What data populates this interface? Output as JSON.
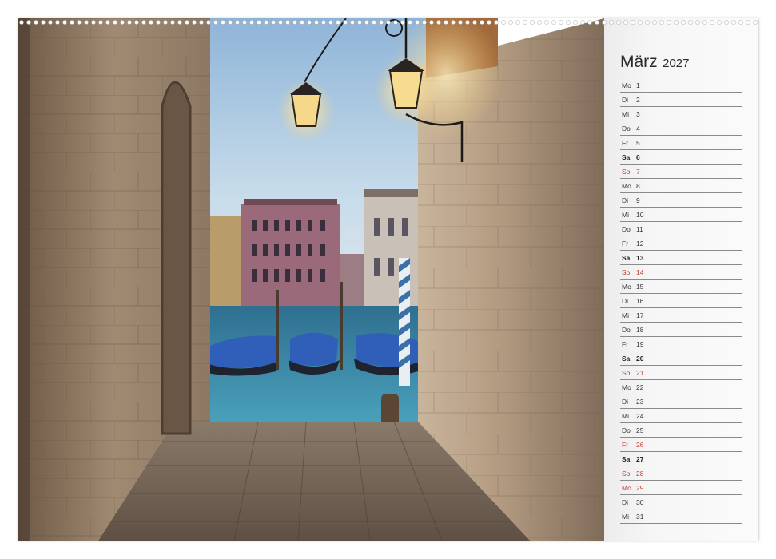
{
  "calendar": {
    "month": "März",
    "year": "2027",
    "days": [
      {
        "wd": "Mo",
        "d": "1",
        "type": "weekday"
      },
      {
        "wd": "Di",
        "d": "2",
        "type": "weekday"
      },
      {
        "wd": "Mi",
        "d": "3",
        "type": "weekday"
      },
      {
        "wd": "Do",
        "d": "4",
        "type": "weekday"
      },
      {
        "wd": "Fr",
        "d": "5",
        "type": "weekday"
      },
      {
        "wd": "Sa",
        "d": "6",
        "type": "sat"
      },
      {
        "wd": "So",
        "d": "7",
        "type": "sun"
      },
      {
        "wd": "Mo",
        "d": "8",
        "type": "weekday"
      },
      {
        "wd": "Di",
        "d": "9",
        "type": "weekday"
      },
      {
        "wd": "Mi",
        "d": "10",
        "type": "weekday"
      },
      {
        "wd": "Do",
        "d": "11",
        "type": "weekday"
      },
      {
        "wd": "Fr",
        "d": "12",
        "type": "weekday"
      },
      {
        "wd": "Sa",
        "d": "13",
        "type": "sat"
      },
      {
        "wd": "So",
        "d": "14",
        "type": "sun"
      },
      {
        "wd": "Mo",
        "d": "15",
        "type": "weekday"
      },
      {
        "wd": "Di",
        "d": "16",
        "type": "weekday"
      },
      {
        "wd": "Mi",
        "d": "17",
        "type": "weekday"
      },
      {
        "wd": "Do",
        "d": "18",
        "type": "weekday"
      },
      {
        "wd": "Fr",
        "d": "19",
        "type": "weekday"
      },
      {
        "wd": "Sa",
        "d": "20",
        "type": "sat"
      },
      {
        "wd": "So",
        "d": "21",
        "type": "sun"
      },
      {
        "wd": "Mo",
        "d": "22",
        "type": "weekday"
      },
      {
        "wd": "Di",
        "d": "23",
        "type": "weekday"
      },
      {
        "wd": "Mi",
        "d": "24",
        "type": "weekday"
      },
      {
        "wd": "Do",
        "d": "25",
        "type": "weekday"
      },
      {
        "wd": "Fr",
        "d": "26",
        "type": "holiday"
      },
      {
        "wd": "Sa",
        "d": "27",
        "type": "sat"
      },
      {
        "wd": "So",
        "d": "28",
        "type": "sun"
      },
      {
        "wd": "Mo",
        "d": "29",
        "type": "holiday"
      },
      {
        "wd": "Di",
        "d": "30",
        "type": "weekday"
      },
      {
        "wd": "Mi",
        "d": "31",
        "type": "weekday"
      }
    ]
  },
  "colors": {
    "sunday_holiday": "#c0392b",
    "saturday": "#222222",
    "weekday": "#333333",
    "gondola_cover": "#2f5fb8",
    "water": "#3a7e99",
    "sky": "#b9d3e8",
    "palazzo": "#9a6a7a"
  },
  "photo": {
    "subject": "venice-canal-passage",
    "icons": [
      "street-lamp-icon",
      "gondola-icon",
      "mooring-pole-icon",
      "palazzo-icon"
    ]
  }
}
